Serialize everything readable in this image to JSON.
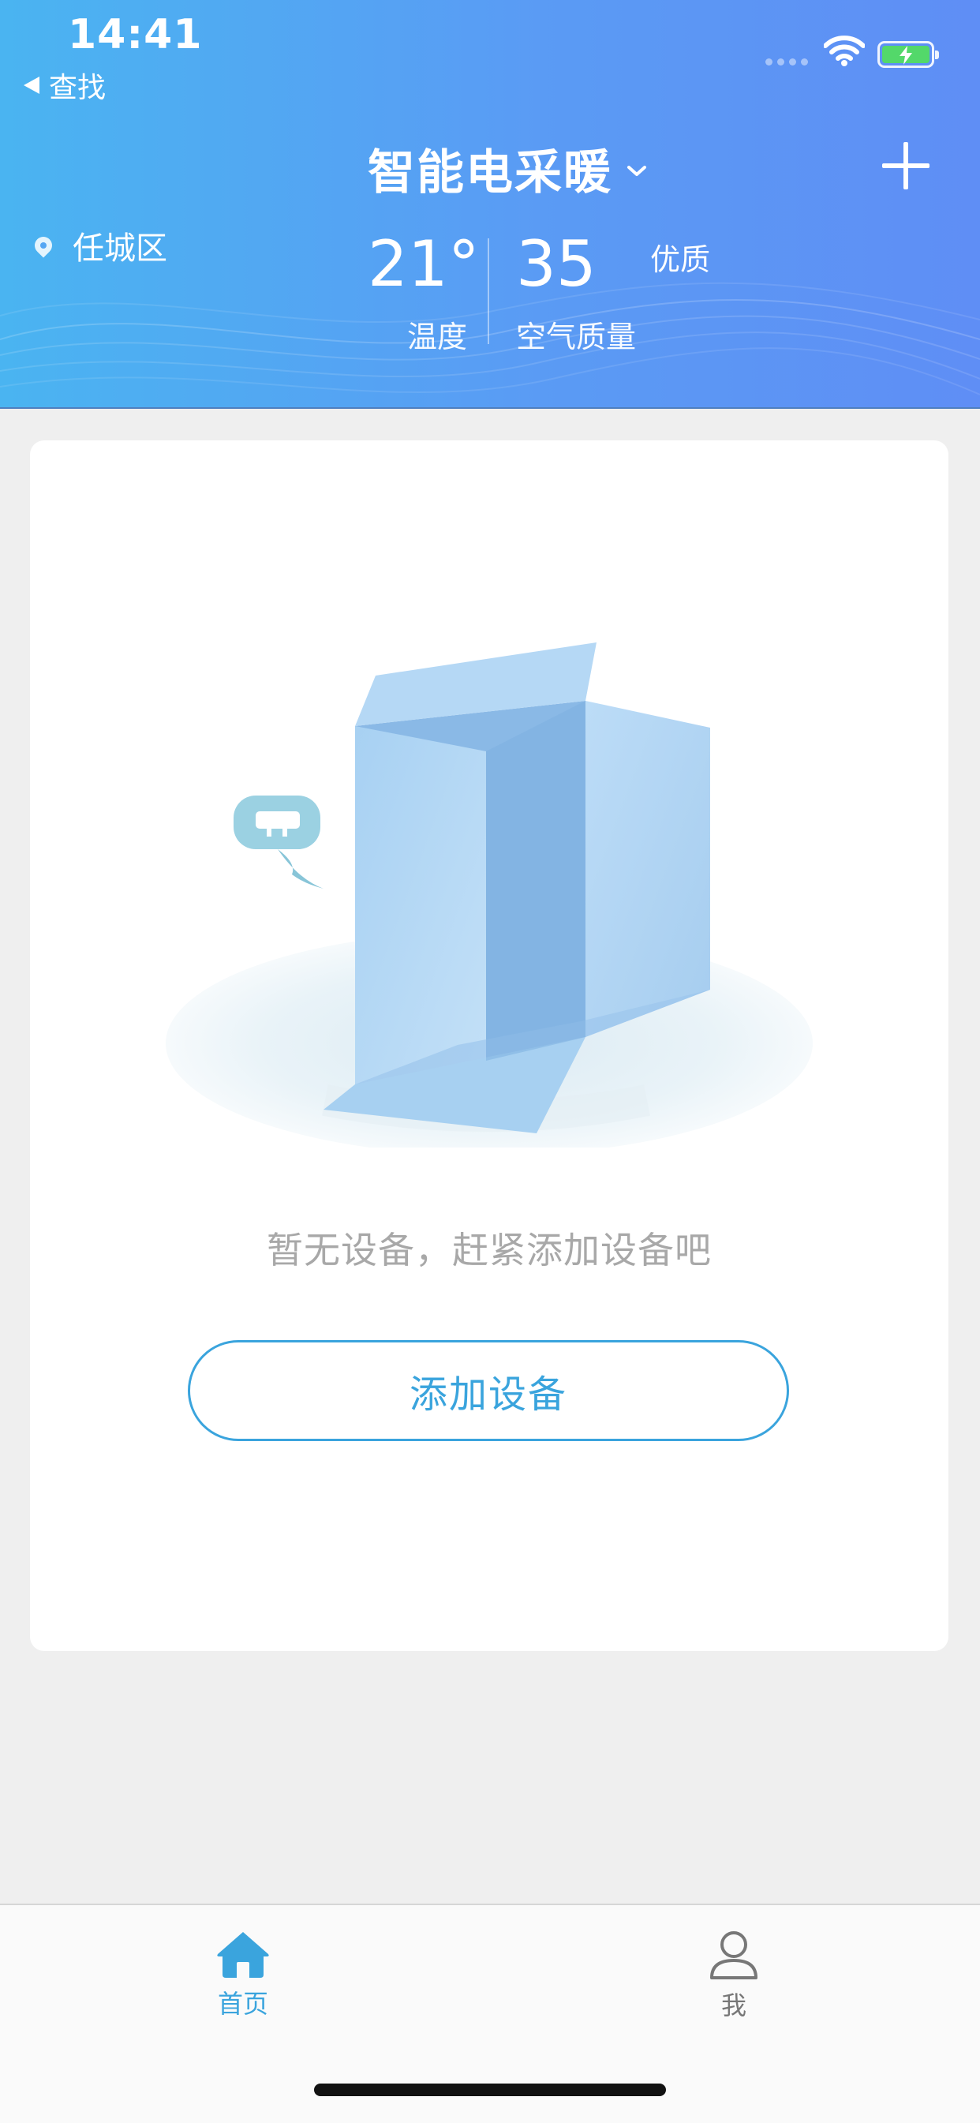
{
  "status_bar": {
    "time": "14:41",
    "back_label": "查找"
  },
  "header": {
    "title": "智能电采暖",
    "location": "任城区",
    "temperature": {
      "value": "21°",
      "label": "温度"
    },
    "air_quality": {
      "value": "35",
      "quality": "优质",
      "label": "空气质量"
    }
  },
  "empty_state": {
    "message": "暂无设备，赶紧添加设备吧",
    "add_button_label": "添加设备"
  },
  "tabbar": {
    "items": [
      {
        "label": "首页",
        "icon": "home-icon",
        "active": true
      },
      {
        "label": "我",
        "icon": "person-icon",
        "active": false
      }
    ]
  },
  "colors": {
    "header_gradient_start": "#4ab4f1",
    "header_gradient_end": "#5f8ef5",
    "accent": "#3aa4dd",
    "page_background": "#efefef",
    "battery_green": "#53d86a"
  }
}
